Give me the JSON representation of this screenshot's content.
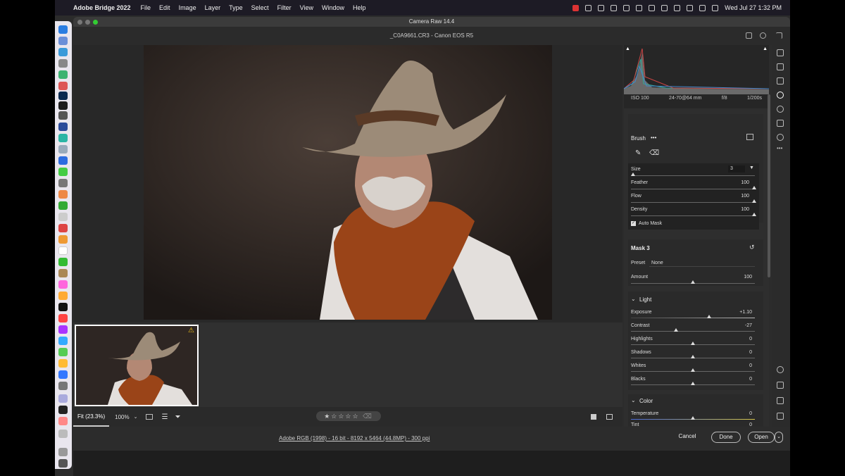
{
  "menubar": {
    "apple": "",
    "app_name": "Adobe Bridge 2022",
    "menus": [
      "File",
      "Edit",
      "Image",
      "Layer",
      "Type",
      "Select",
      "Filter",
      "View",
      "Window",
      "Help"
    ],
    "clock": "Wed Jul 27  1:32 PM"
  },
  "window": {
    "title": "Camera Raw 14.4",
    "filename": "_C0A9661.CR3  -  Canon EOS R5"
  },
  "exif": {
    "iso": "ISO 100",
    "lens": "24-70@64 mm",
    "aperture": "f/8",
    "shutter": "1/200s"
  },
  "brush": {
    "title": "Brush",
    "more": "•••",
    "size_label": "Size",
    "size_value": "3",
    "feather_label": "Feather",
    "feather_value": "100",
    "flow_label": "Flow",
    "flow_value": "100",
    "density_label": "Density",
    "density_value": "100",
    "automask_label": "Auto Mask"
  },
  "mask": {
    "title": "Mask 3",
    "preset_label": "Preset",
    "preset_value": "None",
    "amount_label": "Amount",
    "amount_value": "100"
  },
  "light": {
    "title": "Light",
    "sliders": [
      {
        "label": "Exposure",
        "value": "+1.10"
      },
      {
        "label": "Contrast",
        "value": "-27"
      },
      {
        "label": "Highlights",
        "value": "0"
      },
      {
        "label": "Shadows",
        "value": "0"
      },
      {
        "label": "Whites",
        "value": "0"
      },
      {
        "label": "Blacks",
        "value": "0"
      }
    ]
  },
  "color": {
    "title": "Color",
    "sliders": [
      {
        "label": "Temperature",
        "value": "0"
      },
      {
        "label": "Tint",
        "value": "0"
      }
    ]
  },
  "bottombar": {
    "fit": "Fit (23.3%)",
    "zoom": "100%",
    "stars": "★☆☆☆☆"
  },
  "footer": {
    "info": "Adobe RGB (1998) - 16 bit - 8192 x 5464 (44.8MP) - 300 ppi",
    "cancel": "Cancel",
    "done": "Done",
    "open": "Open"
  }
}
